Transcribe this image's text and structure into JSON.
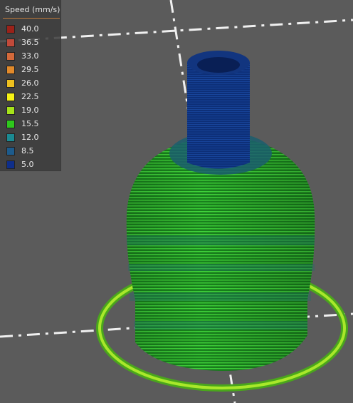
{
  "legend": {
    "title": "Speed (mm/s)",
    "items": [
      {
        "label": "40.0",
        "color": "#9b2219"
      },
      {
        "label": "36.5",
        "color": "#c24a3a"
      },
      {
        "label": "33.0",
        "color": "#d4693a"
      },
      {
        "label": "29.5",
        "color": "#e28a2a"
      },
      {
        "label": "26.0",
        "color": "#eec01f"
      },
      {
        "label": "22.5",
        "color": "#f6f214"
      },
      {
        "label": "19.0",
        "color": "#a6e21a"
      },
      {
        "label": "15.5",
        "color": "#2ec81c"
      },
      {
        "label": "12.0",
        "color": "#1b8a92"
      },
      {
        "label": "8.5",
        "color": "#1d5b8c"
      },
      {
        "label": "5.0",
        "color": "#0e2e8a"
      }
    ]
  }
}
